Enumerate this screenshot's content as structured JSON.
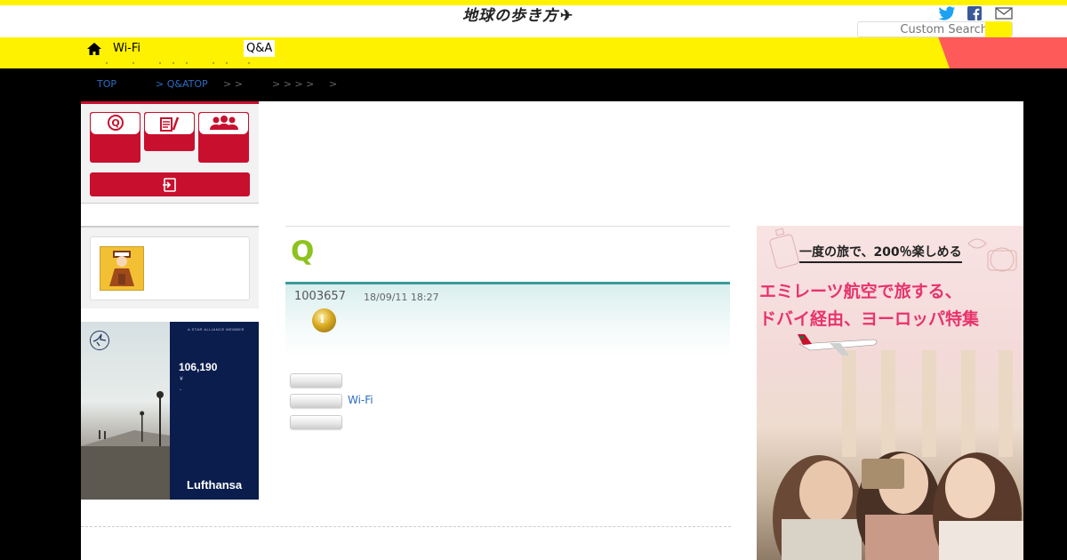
{
  "header": {
    "logo": "地球の歩き方",
    "social": [
      "twitter-icon",
      "facebook-icon",
      "mail-icon"
    ],
    "search_placeholder": "Custom Search"
  },
  "nav": {
    "home_icon": "home-icon",
    "items": [
      "Wi-Fi",
      "Q&A"
    ]
  },
  "breadcrumb": {
    "items": [
      "TOP",
      "> Q&ATOP",
      "> >",
      "> > > >",
      ">"
    ]
  },
  "sidebar": {
    "tiles": [
      "q-icon",
      "notepad-edit-icon",
      "users-icon"
    ],
    "login_icon": "login-icon"
  },
  "question": {
    "mark": "Q",
    "id": "1003657",
    "date": "18/09/11 18:27",
    "medal_icon": "gold-medal-icon",
    "link": "Wi-Fi"
  },
  "ad_lufthansa": {
    "amount": "106,190",
    "currency": "¥",
    "dash": "-",
    "alliance": "A STAR ALLIANCE MEMBER",
    "brand": "Lufthansa"
  },
  "ad_emirates": {
    "tagline": "一度の旅で、200％楽しめる",
    "headline1": "エミレーツ航空で旅する、",
    "headline2": "ドバイ経由、ヨーロッパ特集"
  },
  "colors": {
    "yellow": "#fff200",
    "red": "#c8102e",
    "teal": "#3c9a9a",
    "green_q": "#8dc21f",
    "link_blue": "#2b6cc4",
    "emirates_pink": "#e8336c",
    "lufthansa_navy": "#0a1d4d"
  }
}
